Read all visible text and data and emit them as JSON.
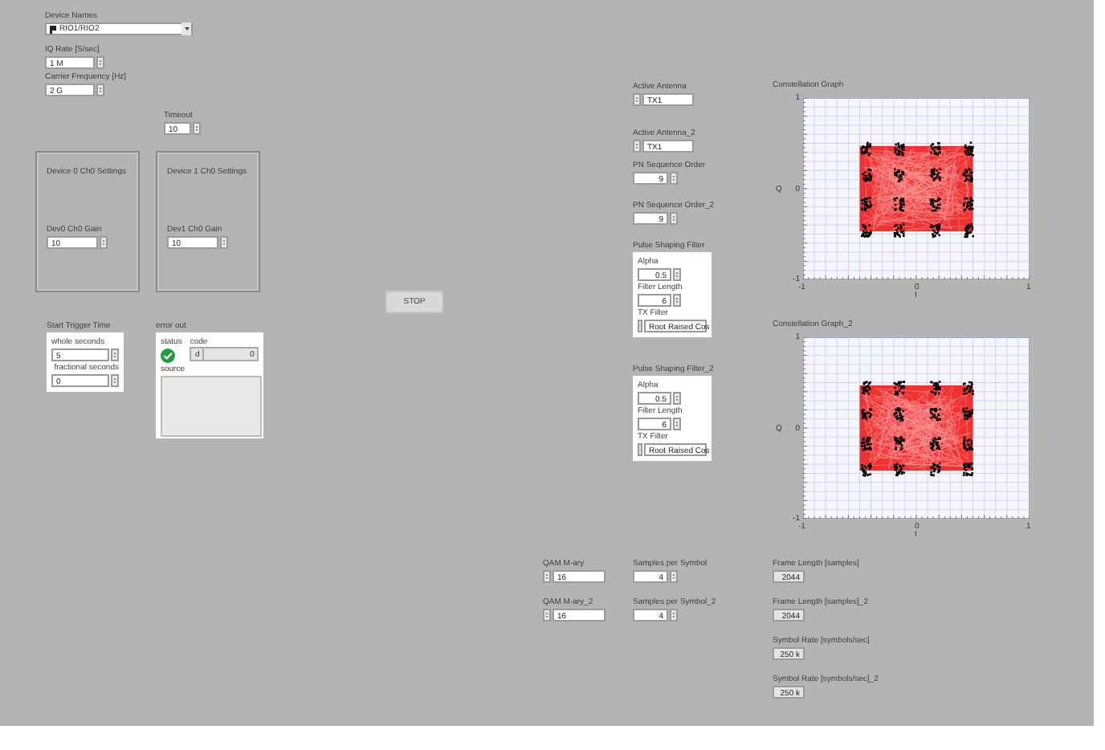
{
  "device_names": {
    "label": "Device Names",
    "value": "RIO1/RIO2"
  },
  "iq_rate": {
    "label": "IQ Rate [S/sec]",
    "value": "1 M"
  },
  "carrier_frequency": {
    "label": "Carrier Frequency [Hz]",
    "value": "2 G"
  },
  "timeout": {
    "label": "Timeout",
    "value": "10"
  },
  "device_settings": [
    {
      "title": "Device 0 Ch0 Settings",
      "gain_label": "Dev0 Ch0 Gain",
      "gain": "10"
    },
    {
      "title": "Device 1 Ch0 Settings",
      "gain_label": "Dev1 Ch0 Gain",
      "gain": "10"
    }
  ],
  "stop_button": "STOP",
  "start_trigger_time": {
    "label": "Start Trigger Time",
    "whole_label": "whole seconds",
    "whole": "5",
    "fractional_label": "fractional seconds",
    "fractional": "0"
  },
  "error_out": {
    "label": "error out",
    "status_label": "status",
    "status_ok": true,
    "code_label": "code",
    "radix": "d",
    "code": "0",
    "source_label": "source"
  },
  "active_antennas": [
    {
      "label": "Active Antenna",
      "value": "TX1"
    },
    {
      "label": "Active Antenna_2",
      "value": "TX1"
    }
  ],
  "pn_sequence_orders": [
    {
      "label": "PN Sequence Order",
      "value": "9"
    },
    {
      "label": "PN Sequence Order_2",
      "value": "9"
    }
  ],
  "pulse_shaping_filters": [
    {
      "label": "Pulse Shaping Filter",
      "alpha_label": "Alpha",
      "alpha": "0.5",
      "filter_length_label": "Filter Length",
      "filter_length": "6",
      "tx_filter_label": "TX Filter",
      "tx_filter": "Root Raised Cos"
    },
    {
      "label": "Pulse Shaping Filter_2",
      "alpha_label": "Alpha",
      "alpha": "0.5",
      "filter_length_label": "Filter Length",
      "filter_length": "6",
      "tx_filter_label": "TX Filter",
      "tx_filter": "Root Raised Cos"
    }
  ],
  "qam_m_ary": [
    {
      "label": "QAM M-ary",
      "value": "16"
    },
    {
      "label": "QAM M-ary_2",
      "value": "16"
    }
  ],
  "samples_per_symbol": [
    {
      "label": "Samples per Symbol",
      "value": "4"
    },
    {
      "label": "Samples per Symbol_2",
      "value": "4"
    }
  ],
  "frame_lengths": [
    {
      "label": "Frame Length [samples]",
      "value": "2044"
    },
    {
      "label": "Frame Length [samples]_2",
      "value": "2044"
    }
  ],
  "symbol_rates": [
    {
      "label": "Symbol Rate [symbols/sec]",
      "value": "250 k"
    },
    {
      "label": "Symbol Rate [symbols/sec]_2",
      "value": "250 k"
    }
  ],
  "constellation_graphs": [
    {
      "title": "Constellation Graph",
      "y_label": "Q",
      "x_label": "I",
      "y_ticks": [
        "1",
        "0",
        "-1"
      ],
      "x_ticks": [
        "-1",
        "0",
        "1"
      ]
    },
    {
      "title": "Constellation Graph_2",
      "y_label": "Q",
      "x_label": "I",
      "y_ticks": [
        "1",
        "0",
        "-1"
      ],
      "x_ticks": [
        "-1",
        "0",
        "1"
      ]
    }
  ]
}
